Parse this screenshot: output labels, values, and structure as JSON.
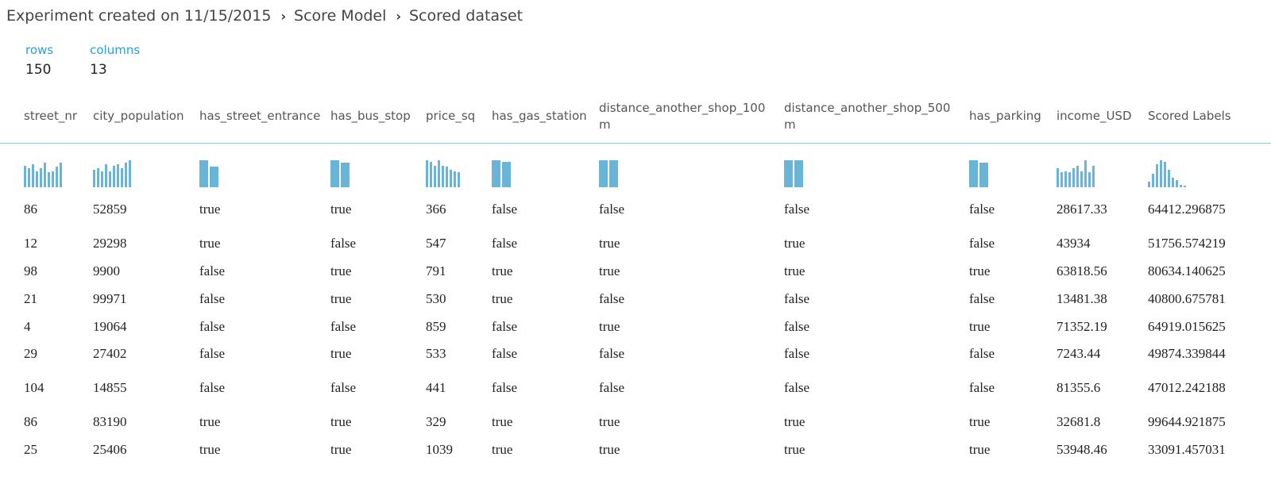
{
  "breadcrumb": {
    "items": [
      "Experiment created on 11/15/2015",
      "Score Model",
      "Scored dataset"
    ],
    "separator": "›"
  },
  "stats": {
    "rows_label": "rows",
    "rows_value": "150",
    "columns_label": "columns",
    "columns_value": "13"
  },
  "columns": [
    {
      "key": "street_nr",
      "header": "street_nr",
      "header_lines": [
        "street_nr"
      ],
      "histogram": [
        0.8,
        0.7,
        0.85,
        0.6,
        0.7,
        0.9,
        0.55,
        0.6,
        0.75,
        0.9
      ]
    },
    {
      "key": "city_population",
      "header": "city_population",
      "header_lines": [
        "city_population"
      ],
      "histogram": [
        0.65,
        0.7,
        0.6,
        0.85,
        0.6,
        0.8,
        0.85,
        0.7,
        0.9,
        1.0
      ]
    },
    {
      "key": "has_street_entrance",
      "header": "has_street_entrance",
      "header_lines": [
        "has_street_entrance"
      ],
      "histogram": [
        1.0,
        0.75
      ]
    },
    {
      "key": "has_bus_stop",
      "header": "has_bus_stop",
      "header_lines": [
        "has_bus_stop"
      ],
      "histogram": [
        1.0,
        0.92
      ]
    },
    {
      "key": "price_sq",
      "header": "price_sq",
      "header_lines": [
        "price_sq"
      ],
      "histogram": [
        1.0,
        0.95,
        0.8,
        1.0,
        0.8,
        0.75,
        0.65,
        0.6,
        0.55
      ]
    },
    {
      "key": "has_gas_station",
      "header": "has_gas_station",
      "header_lines": [
        "has_gas_station"
      ],
      "histogram": [
        1.0,
        0.95
      ]
    },
    {
      "key": "distance_another_shop_100m",
      "header": "distance_another_shop_100m",
      "header_lines": [
        "distance_another_shop_100",
        "m"
      ],
      "histogram": [
        1.0,
        1.0
      ]
    },
    {
      "key": "distance_another_shop_500m",
      "header": "distance_another_shop_500m",
      "header_lines": [
        "distance_another_shop_500",
        "m"
      ],
      "histogram": [
        1.0,
        1.0
      ]
    },
    {
      "key": "has_parking",
      "header": "has_parking",
      "header_lines": [
        "has_parking"
      ],
      "histogram": [
        1.0,
        0.9
      ]
    },
    {
      "key": "income_USD",
      "header": "income_USD",
      "header_lines": [
        "income_USD"
      ],
      "histogram": [
        0.7,
        0.55,
        0.6,
        0.55,
        0.7,
        0.8,
        0.6,
        1.0,
        0.55,
        0.8
      ]
    },
    {
      "key": "Scored_Labels",
      "header": "Scored Labels",
      "header_lines": [
        "Scored Labels"
      ],
      "histogram": [
        0.2,
        0.5,
        0.85,
        1.0,
        0.95,
        0.65,
        0.35,
        0.25,
        0.1,
        0.05
      ]
    }
  ],
  "rows": [
    [
      "86",
      "52859",
      "true",
      "true",
      "366",
      "false",
      "false",
      "false",
      "false",
      "28617.33",
      "64412.296875"
    ],
    [
      "12",
      "29298",
      "true",
      "false",
      "547",
      "false",
      "true",
      "true",
      "false",
      "43934",
      "51756.574219"
    ],
    [
      "98",
      "9900",
      "false",
      "true",
      "791",
      "true",
      "true",
      "true",
      "true",
      "63818.56",
      "80634.140625"
    ],
    [
      "21",
      "99971",
      "false",
      "true",
      "530",
      "true",
      "false",
      "false",
      "false",
      "13481.38",
      "40800.675781"
    ],
    [
      "4",
      "19064",
      "false",
      "false",
      "859",
      "false",
      "true",
      "false",
      "true",
      "71352.19",
      "64919.015625"
    ],
    [
      "29",
      "27402",
      "false",
      "true",
      "533",
      "false",
      "false",
      "false",
      "false",
      "7243.44",
      "49874.339844"
    ],
    [
      "104",
      "14855",
      "false",
      "false",
      "441",
      "false",
      "false",
      "false",
      "false",
      "81355.6",
      "47012.242188"
    ],
    [
      "86",
      "83190",
      "true",
      "true",
      "329",
      "true",
      "true",
      "true",
      "true",
      "32681.8",
      "99644.921875"
    ],
    [
      "25",
      "25406",
      "true",
      "true",
      "1039",
      "true",
      "true",
      "true",
      "true",
      "53948.46",
      "33091.457031"
    ]
  ],
  "colors": {
    "accent": "#2a9fd6",
    "histogram": "#69b5d8",
    "divider": "#9cc5d6"
  }
}
